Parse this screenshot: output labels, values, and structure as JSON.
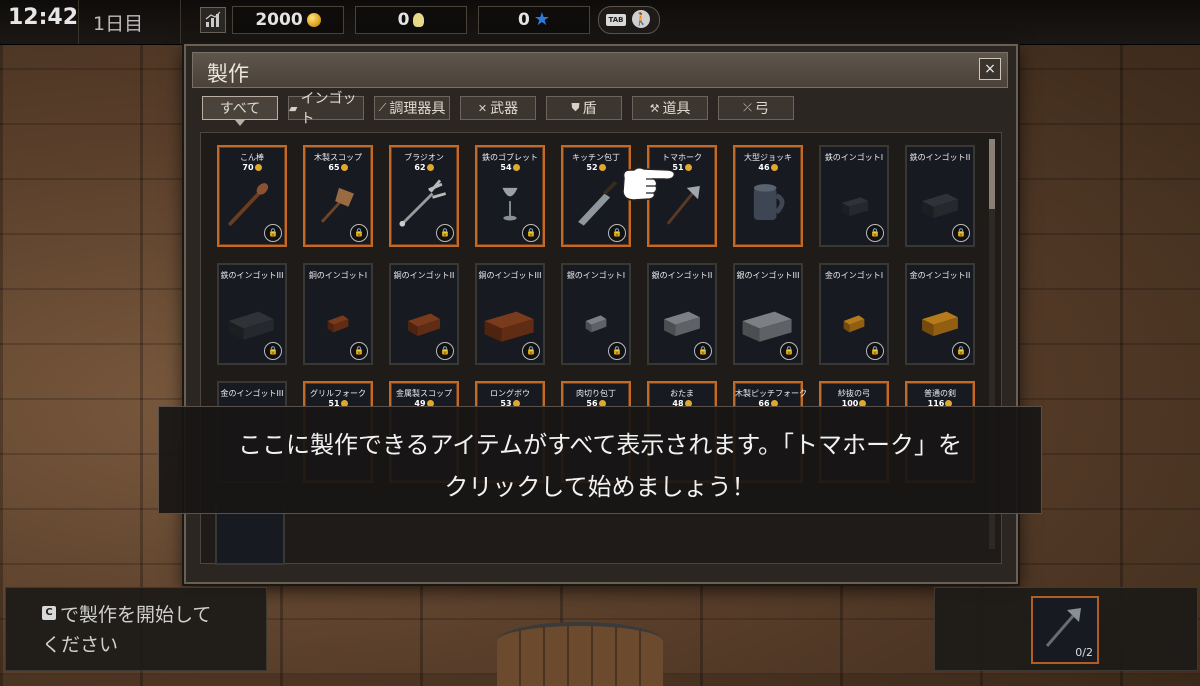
{
  "hud": {
    "clock": "12:42",
    "day": "1日目",
    "gold": "2000",
    "ideas": "0",
    "stars": "0",
    "tab_key": "TAB"
  },
  "window": {
    "title": "製作",
    "close": "×",
    "tabs": [
      {
        "label": "すべて",
        "icon": ""
      },
      {
        "label": "インゴット",
        "icon": "ingot-icon"
      },
      {
        "label": "調理器具",
        "icon": "utensil-icon"
      },
      {
        "label": "武器",
        "icon": "crossed-swords-icon"
      },
      {
        "label": "盾",
        "icon": "shield-icon"
      },
      {
        "label": "道具",
        "icon": "hammer-icon"
      },
      {
        "label": "弓",
        "icon": "bow-icon"
      }
    ]
  },
  "items": [
    {
      "name": "こん棒",
      "cost": "70"
    },
    {
      "name": "木製スコップ",
      "cost": "65"
    },
    {
      "name": "ブラジオン",
      "cost": "62"
    },
    {
      "name": "鉄のゴブレット",
      "cost": "54"
    },
    {
      "name": "キッチン包丁",
      "cost": "52"
    },
    {
      "name": "トマホーク",
      "cost": "51"
    },
    {
      "name": "大型ジョッキ",
      "cost": "46"
    },
    {
      "name": "鉄のインゴットI",
      "cost": ""
    },
    {
      "name": "鉄のインゴットII",
      "cost": ""
    },
    {
      "name": "鉄のインゴットIII",
      "cost": ""
    },
    {
      "name": "銅のインゴットI",
      "cost": ""
    },
    {
      "name": "銅のインゴットII",
      "cost": ""
    },
    {
      "name": "銅のインゴットIII",
      "cost": ""
    },
    {
      "name": "銀のインゴットI",
      "cost": ""
    },
    {
      "name": "銀のインゴットII",
      "cost": ""
    },
    {
      "name": "銀のインゴットIII",
      "cost": ""
    },
    {
      "name": "金のインゴットI",
      "cost": ""
    },
    {
      "name": "金のインゴットII",
      "cost": ""
    },
    {
      "name": "金のインゴットIII",
      "cost": ""
    },
    {
      "name": "グリルフォーク",
      "cost": "51"
    },
    {
      "name": "金属製スコップ",
      "cost": "49"
    },
    {
      "name": "ロングボウ",
      "cost": "53"
    },
    {
      "name": "肉切り包丁",
      "cost": "56"
    },
    {
      "name": "おたま",
      "cost": "48"
    },
    {
      "name": "木製ピッチフォーク",
      "cost": "66"
    },
    {
      "name": "紗抜の弓",
      "cost": "100"
    },
    {
      "name": "普通の剣",
      "cost": "116"
    }
  ],
  "tutorial": {
    "line1": "ここに製作できるアイテムがすべて表示されます。「トマホーク」を",
    "line2": "クリックして始めましょう！"
  },
  "hint": {
    "key": "C",
    "line1": "で製作を開始して",
    "line2": "ください"
  },
  "progress": {
    "count": "0/2"
  }
}
